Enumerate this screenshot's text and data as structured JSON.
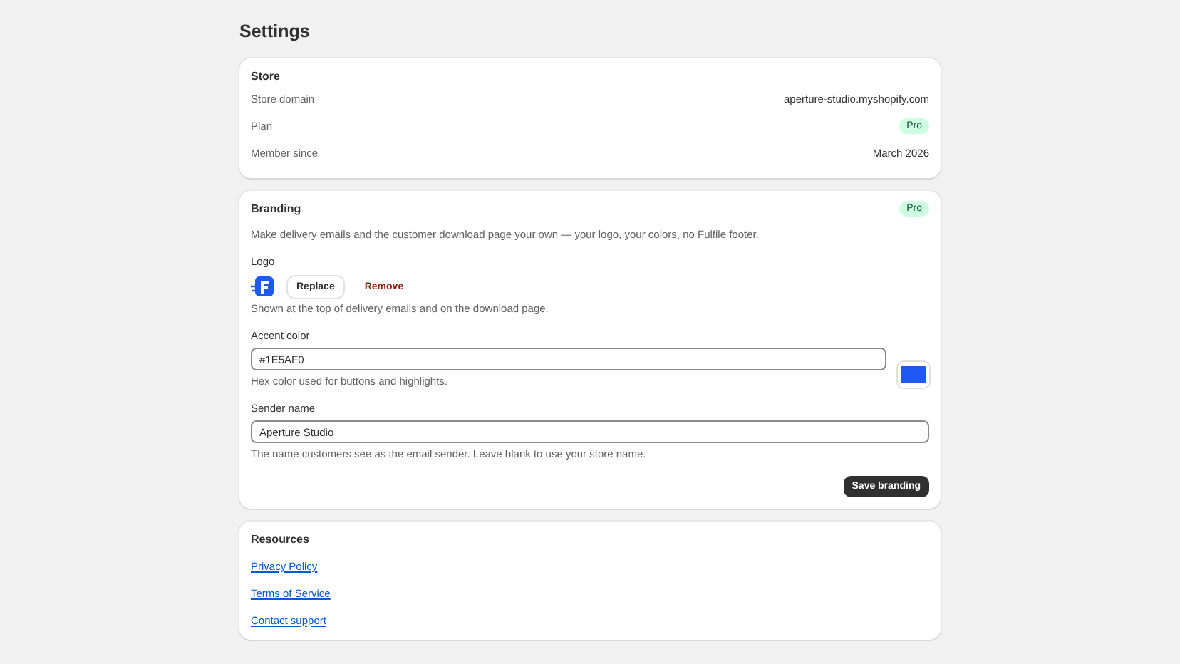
{
  "page": {
    "title": "Settings"
  },
  "store": {
    "title": "Store",
    "rows": [
      {
        "label": "Store domain",
        "kind": "text",
        "value": "aperture-studio.myshopify.com"
      },
      {
        "label": "Plan",
        "kind": "badge",
        "value": "Pro"
      },
      {
        "label": "Member since",
        "kind": "text",
        "value": "March 2026"
      }
    ]
  },
  "branding": {
    "title": "Branding",
    "badge": "Pro",
    "description": "Make delivery emails and the customer download page your own — your logo, your colors, no Fulfile footer.",
    "logo": {
      "label": "Logo",
      "replace_button": "Replace",
      "remove_button": "Remove",
      "help": "Shown at the top of delivery emails and on the download page."
    },
    "accent_color": {
      "label": "Accent color",
      "value": "#1E5AF0",
      "help": "Hex color used for buttons and highlights."
    },
    "sender_name": {
      "label": "Sender name",
      "value": "Aperture Studio",
      "help": "The name customers see as the email sender. Leave blank to use your store name."
    },
    "save_button": "Save branding"
  },
  "resources": {
    "title": "Resources",
    "links": [
      "Privacy Policy",
      "Terms of Service",
      "Contact support"
    ]
  }
}
